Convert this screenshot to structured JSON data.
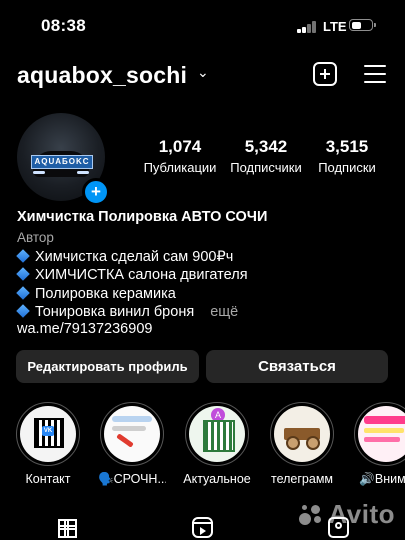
{
  "status_bar": {
    "time": "08:38",
    "network": "LTE",
    "battery_percent": 55
  },
  "header": {
    "username": "aquabox_sochi",
    "chevron_icon": "chevron-down-icon",
    "create_icon": "plus-square-icon",
    "menu_icon": "hamburger-menu-icon"
  },
  "avatar": {
    "plate_text": "AQUAБOKC",
    "add_icon": "plus-icon",
    "accent": "#0095f6"
  },
  "stats": [
    {
      "value": "1,074",
      "label": "Публикации"
    },
    {
      "value": "5,342",
      "label": "Подписчики"
    },
    {
      "value": "3,515",
      "label": "Подписки"
    }
  ],
  "bio": {
    "name": "Химчистка Полировка АВТО СОЧИ",
    "category": "Автор",
    "lines": [
      "Химчистка сделай сам 900₽ч",
      "ХИМЧИСТКА салона двигателя",
      "Полировка керамика",
      "Тонировка винил броня"
    ],
    "more": "ещё",
    "link": "wa.me/79137236909"
  },
  "buttons": {
    "edit": "Редактировать профиль",
    "contact": "Связаться"
  },
  "highlights": [
    {
      "label": "Контакт"
    },
    {
      "label": "🗣️СРОЧН..."
    },
    {
      "label": "Актуальное"
    },
    {
      "label": "телеграмм"
    },
    {
      "label": "🔊Внима"
    }
  ],
  "tabs": {
    "grid_icon": "grid-icon",
    "reels_icon": "reels-icon",
    "tagged_icon": "tagged-user-icon"
  },
  "watermark": "Avito"
}
